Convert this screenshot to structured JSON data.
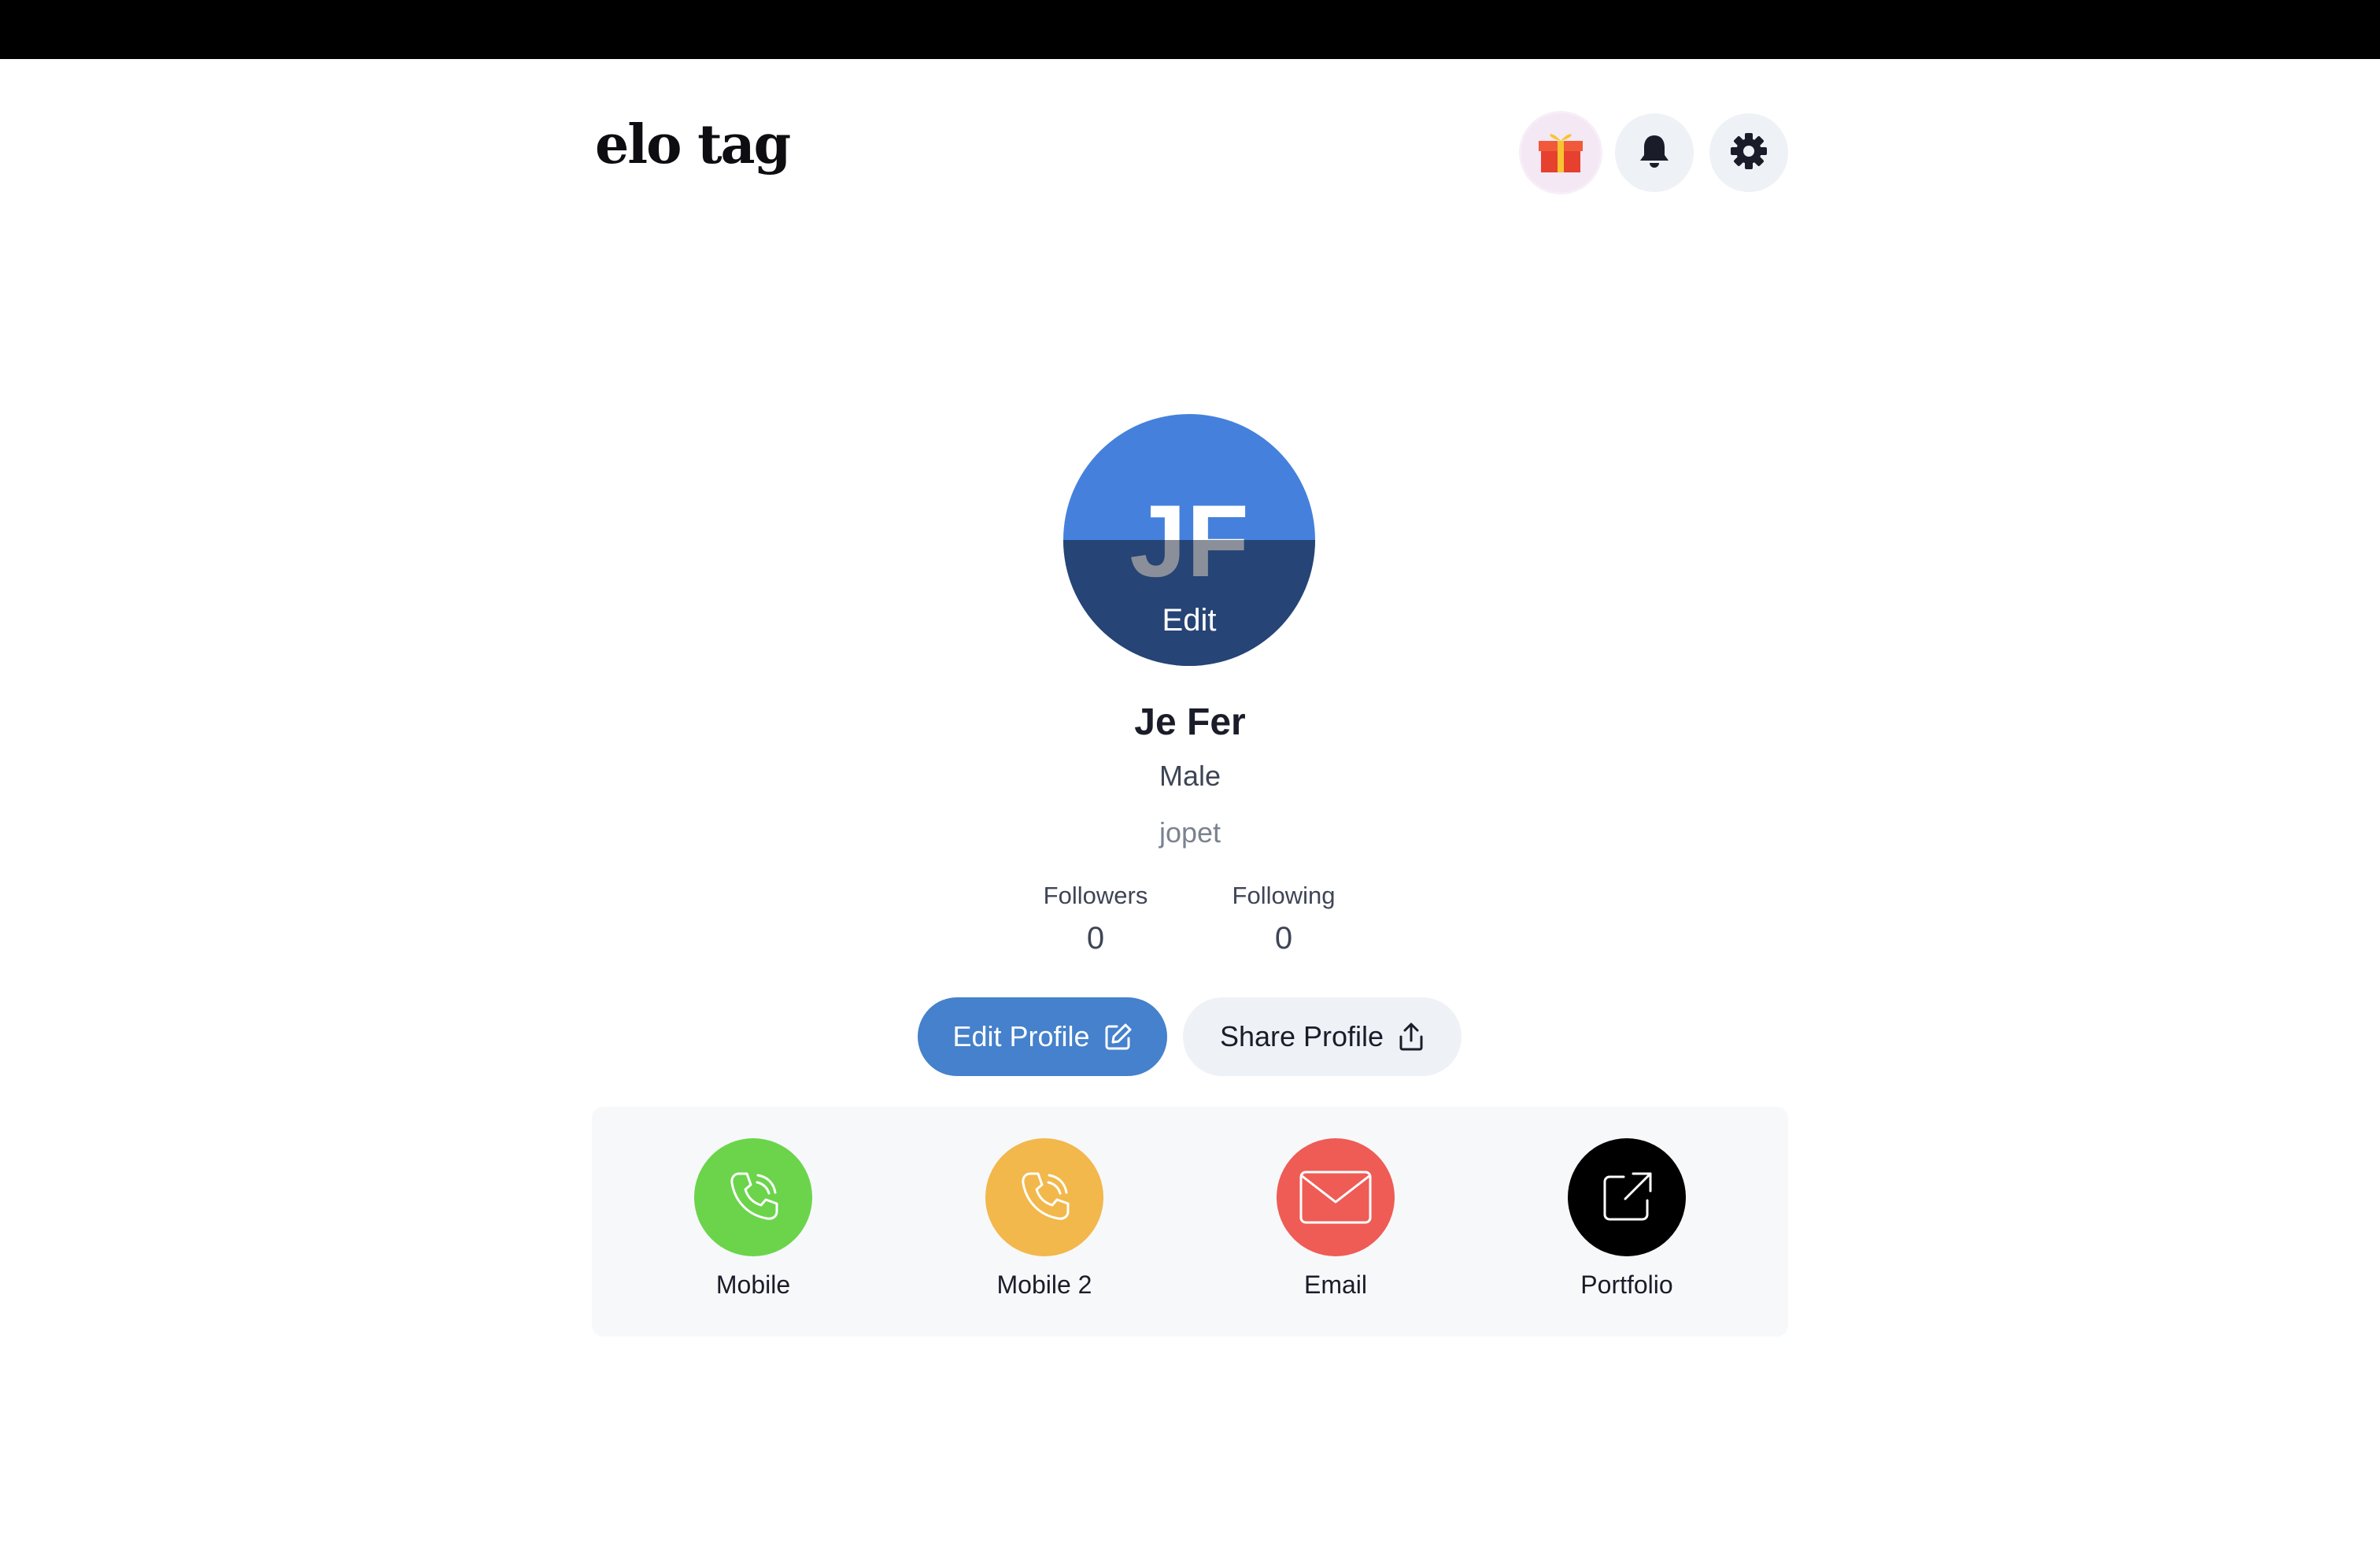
{
  "header": {
    "logo": "elo tag",
    "icons": [
      "gift-icon",
      "bell-icon",
      "gear-icon"
    ]
  },
  "profile": {
    "initials": "JF",
    "edit_label": "Edit",
    "name": "Je Fer",
    "gender": "Male",
    "username": "jopet",
    "followers_label": "Followers",
    "followers_count": "0",
    "following_label": "Following",
    "following_count": "0"
  },
  "actions": {
    "edit_profile": "Edit Profile",
    "share_profile": "Share Profile"
  },
  "links": [
    {
      "label": "Mobile",
      "icon": "phone-icon",
      "color": "#6bd44b"
    },
    {
      "label": "Mobile 2",
      "icon": "phone-icon",
      "color": "#f2b84b"
    },
    {
      "label": "Email",
      "icon": "mail-icon",
      "color": "#ee5c55"
    },
    {
      "label": "Portfolio",
      "icon": "external-link-icon",
      "color": "#000000"
    }
  ],
  "colors": {
    "accent": "#4581cc",
    "avatar_bg": "#4581dc"
  }
}
